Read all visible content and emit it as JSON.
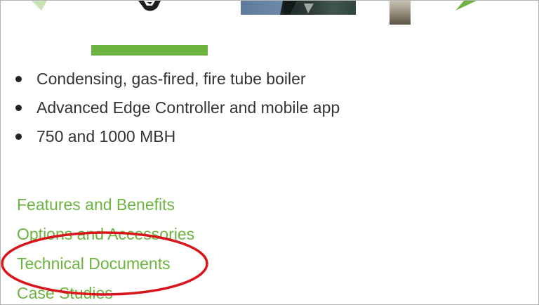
{
  "features": [
    "Condensing, gas-fired, fire tube boiler",
    "Advanced Edge Controller and mobile app",
    "750 and 1000 MBH"
  ],
  "links": [
    "Features and Benefits",
    "Options and Accessories",
    "Technical Documents",
    "Case Studies"
  ],
  "colors": {
    "accent_green": "#6cb33f",
    "annotation_red": "#d9151b"
  },
  "icons": {
    "carousel_prev": "chevron-left-icon",
    "carousel_next": "chevron-right-icon"
  }
}
